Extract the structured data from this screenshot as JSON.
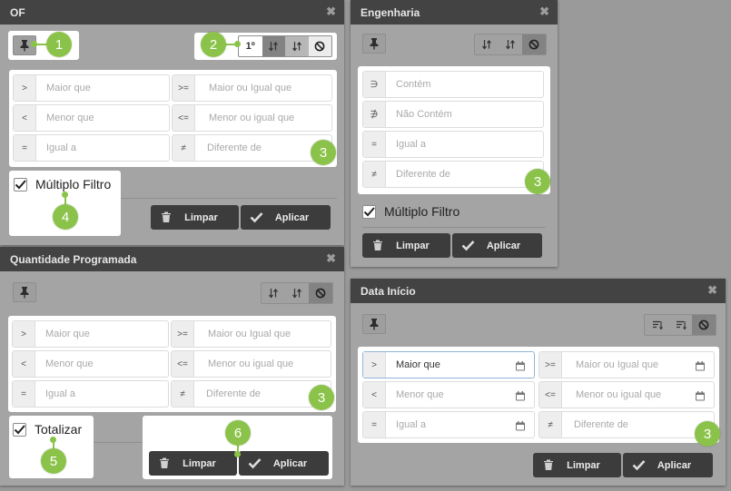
{
  "panels": {
    "of": {
      "title": "OF",
      "sort_order": "1º",
      "filters": [
        "Maior que",
        "Maior ou Igual que",
        "Menor que",
        "Menor ou igual que",
        "Igual a",
        "Diferente de"
      ],
      "ops": [
        ">",
        ">=",
        "<",
        "<=",
        "=",
        "≠"
      ],
      "option_label": "Múltiplo Filtro",
      "clear_label": "Limpar",
      "apply_label": "Aplicar"
    },
    "engenharia": {
      "title": "Engenharia",
      "filters": [
        "Contém",
        "Não Contém",
        "Igual a",
        "Diferente de"
      ],
      "ops": [
        "∋",
        "∌",
        "=",
        "≠"
      ],
      "option_label": "Múltiplo Filtro",
      "clear_label": "Limpar",
      "apply_label": "Aplicar"
    },
    "quantidade": {
      "title": "Quantidade Programada",
      "filters": [
        "Maior que",
        "Maior ou Igual que",
        "Menor que",
        "Menor ou igual que",
        "Igual a",
        "Diferente de"
      ],
      "ops": [
        ">",
        ">=",
        "<",
        "<=",
        "=",
        "≠"
      ],
      "option_label": "Totalizar",
      "clear_label": "Limpar",
      "apply_label": "Aplicar"
    },
    "data_inicio": {
      "title": "Data Início",
      "filters": [
        "Maior que",
        "Maior ou Igual que",
        "Menor que",
        "Menor ou igual que",
        "Igual a",
        "Diferente de"
      ],
      "ops": [
        ">",
        ">=",
        "<",
        "<=",
        "=",
        "≠"
      ],
      "clear_label": "Limpar",
      "apply_label": "Aplicar"
    }
  },
  "close_glyph": "✖",
  "badges": {
    "b1": "1",
    "b2": "2",
    "b3": "3",
    "b4": "4",
    "b5": "5",
    "b6": "6"
  },
  "icons": {
    "pin": "pin-icon",
    "sort_asc": "sort-ascending-icon",
    "sort_desc": "sort-descending-icon",
    "no_sort": "no-sort-icon",
    "calendar": "calendar-icon",
    "trash": "trash-icon",
    "check": "check-icon"
  },
  "colors": {
    "title_bar": "#434343",
    "panel_bg": "#a4a4a4",
    "button_bg": "#3c3c3c",
    "badge": "#8bc34a",
    "active_sort": "#838383"
  }
}
